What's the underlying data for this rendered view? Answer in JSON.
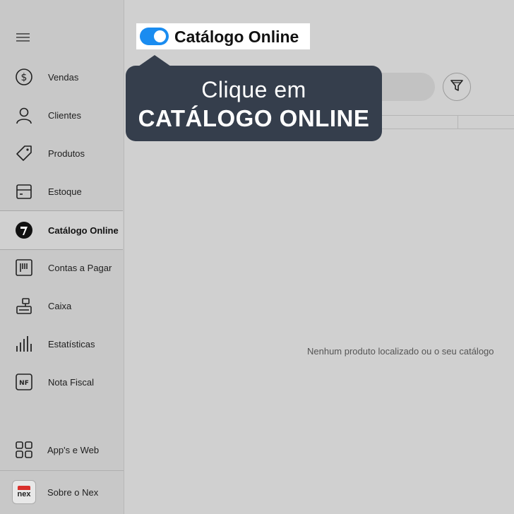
{
  "sidebar": {
    "items": [
      {
        "label": "Vendas",
        "icon": "dollar-circle-icon"
      },
      {
        "label": "Clientes",
        "icon": "user-icon"
      },
      {
        "label": "Produtos",
        "icon": "tag-icon"
      },
      {
        "label": "Estoque",
        "icon": "box-icon"
      },
      {
        "label": "Catálogo Online",
        "icon": "catalog-icon",
        "active": true
      },
      {
        "label": "Contas a Pagar",
        "icon": "barcode-icon"
      },
      {
        "label": "Caixa",
        "icon": "cash-register-icon"
      },
      {
        "label": "Estatísticas",
        "icon": "bar-chart-icon"
      },
      {
        "label": "Nota Fiscal",
        "icon": "nf-icon",
        "badge": "NF"
      }
    ],
    "apps_label": "App's e Web",
    "about_label": "Sobre o Nex",
    "about_logo_text": "nex"
  },
  "header": {
    "toggle_label": "Catálogo Online",
    "toggle_on": true,
    "accent_color": "#1a8cf0"
  },
  "tooltip": {
    "line1": "Clique em",
    "line2": "CATÁLOGO ONLINE",
    "background": "#353e4c"
  },
  "main": {
    "empty_message": "Nenhum produto localizado ou o seu catálogo"
  }
}
